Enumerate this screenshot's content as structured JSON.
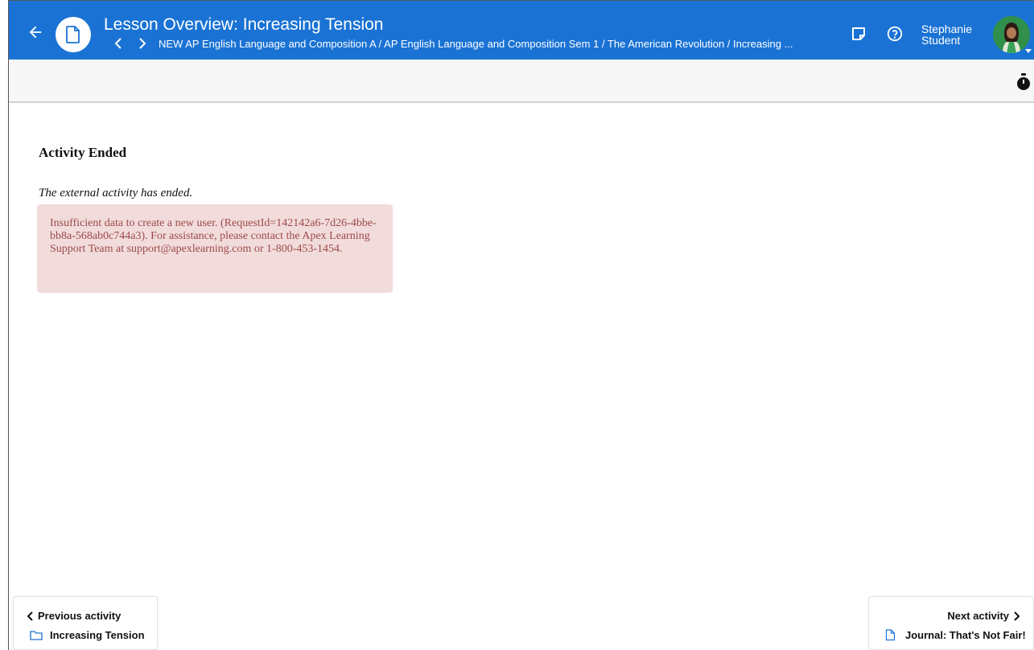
{
  "header": {
    "title": "Lesson Overview: Increasing Tension",
    "breadcrumb": "NEW AP English Language and Composition A / AP English Language and Composition Sem 1 / The American Revolution / Increasing ...",
    "user_first": "Stephanie",
    "user_last": "Student",
    "icons": [
      "back-arrow-icon",
      "document-icon",
      "chevron-left-icon",
      "chevron-right-icon",
      "notes-icon",
      "help-icon",
      "avatar",
      "caret-down-icon"
    ],
    "color": "#1a73d4"
  },
  "toolbar": {
    "icons": [
      "stopwatch-icon"
    ]
  },
  "activity": {
    "title": "Activity Ended",
    "subtitle": "The external activity has ended.",
    "error_message": "Insufficient data to create a new user. (RequestId=142142a6-7d26-4bbe-bb8a-568ab0c744a3). For assistance, please contact the Apex Learning Support Team at support@apexlearning.com or 1-800-453-1454.",
    "error_bg": "#f2dbdb",
    "error_text_color": "#9b4a4a"
  },
  "navigation": {
    "previous_label": "Previous activity",
    "previous_item": "Increasing Tension",
    "next_label": "Next activity",
    "next_item": "Journal: That's Not Fair!"
  }
}
